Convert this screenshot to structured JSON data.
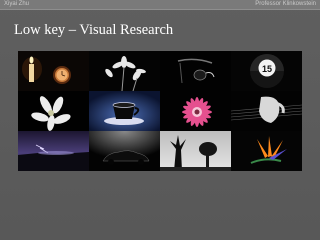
{
  "header": {
    "author": "Xiyai Zhu",
    "professor": "Professor Klinkowstein"
  },
  "slide": {
    "title": "Low key – Visual Research"
  },
  "gallery": {
    "style": "low key photography collage",
    "tiles": [
      {
        "icon": "candle-clock-icon"
      },
      {
        "icon": "flowers-icon"
      },
      {
        "icon": "dark-object-icon"
      },
      {
        "icon": "billiard-ball-15-icon"
      },
      {
        "icon": "lily-icon"
      },
      {
        "icon": "teacup-icon"
      },
      {
        "icon": "pink-gerbera-icon"
      },
      {
        "icon": "hand-guitar-icon"
      },
      {
        "icon": "night-sky-icon"
      },
      {
        "icon": "car-silhouette-icon"
      },
      {
        "icon": "tree-silhouettes-icon"
      },
      {
        "icon": "bird-of-paradise-icon"
      }
    ]
  }
}
